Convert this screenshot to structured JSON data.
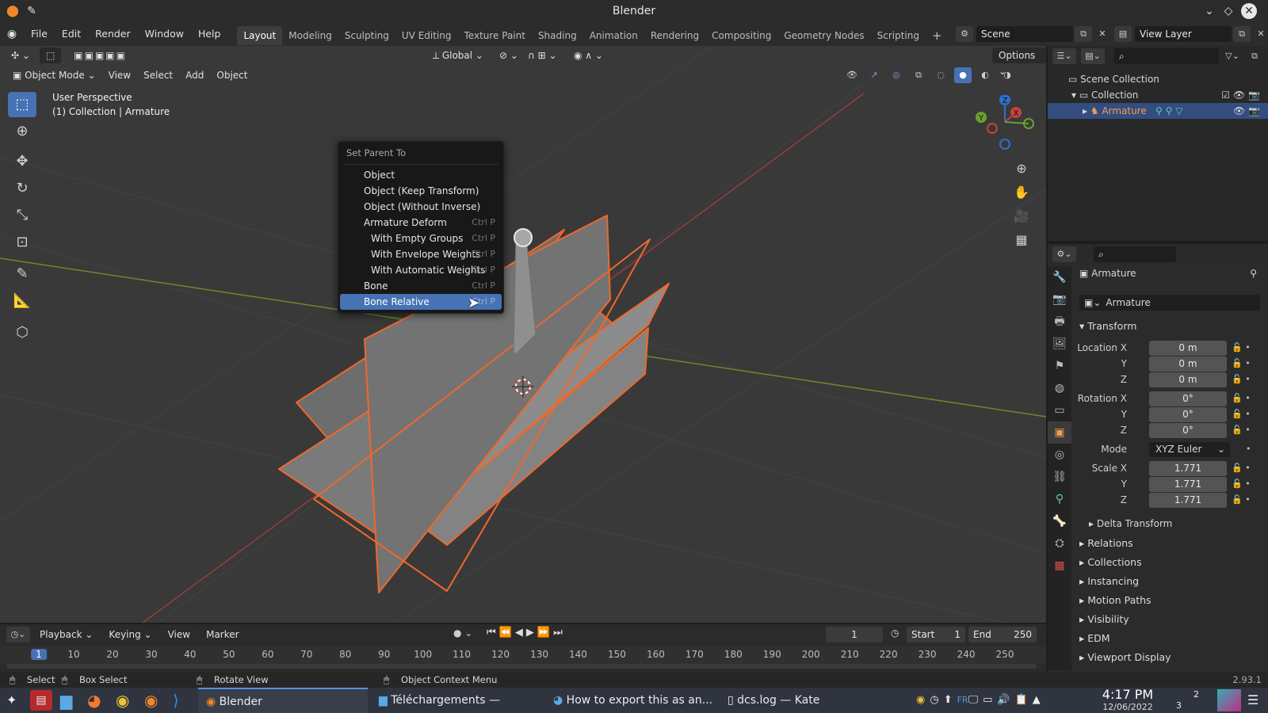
{
  "window": {
    "title": "Blender"
  },
  "menubar": {
    "menus": [
      "File",
      "Edit",
      "Render",
      "Window",
      "Help"
    ],
    "workspaces": [
      "Layout",
      "Modeling",
      "Sculpting",
      "UV Editing",
      "Texture Paint",
      "Shading",
      "Animation",
      "Rendering",
      "Compositing",
      "Geometry Nodes",
      "Scripting"
    ],
    "active_workspace": "Layout",
    "scene": "Scene",
    "view_layer": "View Layer"
  },
  "viewport_header": {
    "orientation": "Global",
    "options_label": "Options",
    "mode": "Object Mode",
    "menus": [
      "View",
      "Select",
      "Add",
      "Object"
    ]
  },
  "viewport": {
    "perspective": "User Perspective",
    "collection_info": "(1) Collection | Armature",
    "gizmo_axes": [
      "Z",
      "X",
      "Y"
    ]
  },
  "context_menu": {
    "title": "Set Parent To",
    "items": [
      {
        "label": "Object",
        "shortcut": ""
      },
      {
        "label": "Object (Keep Transform)",
        "shortcut": ""
      },
      {
        "label": "Object (Without Inverse)",
        "shortcut": ""
      },
      {
        "label": "Armature Deform",
        "shortcut": "Ctrl P"
      },
      {
        "label": "With Empty Groups",
        "shortcut": "Ctrl P"
      },
      {
        "label": "With Envelope Weights",
        "shortcut": "Ctrl P"
      },
      {
        "label": "With Automatic Weights",
        "shortcut": "Ctrl P"
      },
      {
        "label": "Bone",
        "shortcut": "Ctrl P"
      },
      {
        "label": "Bone Relative",
        "shortcut": "Ctrl P"
      }
    ],
    "highlighted": "Bone Relative"
  },
  "outliner": {
    "scene_collection": "Scene Collection",
    "collection": "Collection",
    "object": "Armature"
  },
  "properties": {
    "object_name": "Armature",
    "data_name": "Armature",
    "transform_title": "Transform",
    "location_label": "Location X",
    "rotation_label": "Rotation X",
    "scale_label": "Scale X",
    "y_label": "Y",
    "z_label": "Z",
    "location": [
      "0 m",
      "0 m",
      "0 m"
    ],
    "rotation": [
      "0°",
      "0°",
      "0°"
    ],
    "mode_label": "Mode",
    "mode_value": "XYZ Euler",
    "scale": [
      "1.771",
      "1.771",
      "1.771"
    ],
    "delta_transform": "Delta Transform",
    "panels": [
      "Relations",
      "Collections",
      "Instancing",
      "Motion Paths",
      "Visibility",
      "EDM",
      "Viewport Display"
    ]
  },
  "timeline": {
    "menus": [
      "Playback",
      "Keying",
      "View",
      "Marker"
    ],
    "current_frame": "1",
    "start_label": "Start",
    "start": "1",
    "end_label": "End",
    "end": "250",
    "ruler": [
      "1",
      "10",
      "20",
      "30",
      "40",
      "50",
      "60",
      "70",
      "80",
      "90",
      "100",
      "110",
      "120",
      "130",
      "140",
      "150",
      "160",
      "170",
      "180",
      "190",
      "200",
      "210",
      "220",
      "230",
      "240",
      "250"
    ]
  },
  "statusbar": {
    "select": "Select",
    "box_select": "Box Select",
    "rotate_view": "Rotate View",
    "context_menu": "Object Context Menu",
    "version": "2.93.1"
  },
  "taskbar": {
    "blender": "Blender",
    "dolphin": "Téléchargements — Dolphin",
    "browser": "How to export this as an...",
    "kate": "dcs.log — Kate",
    "lang": "FR",
    "time": "4:17 PM",
    "date": "12/06/2022",
    "desktops": [
      "2",
      "3"
    ]
  },
  "colors": {
    "accent": "#4772b3",
    "selection_orange": "#f0682a",
    "viewport_bg": "#393939",
    "x_axis": "#9b3b3b",
    "y_axis": "#6a8a2b"
  }
}
